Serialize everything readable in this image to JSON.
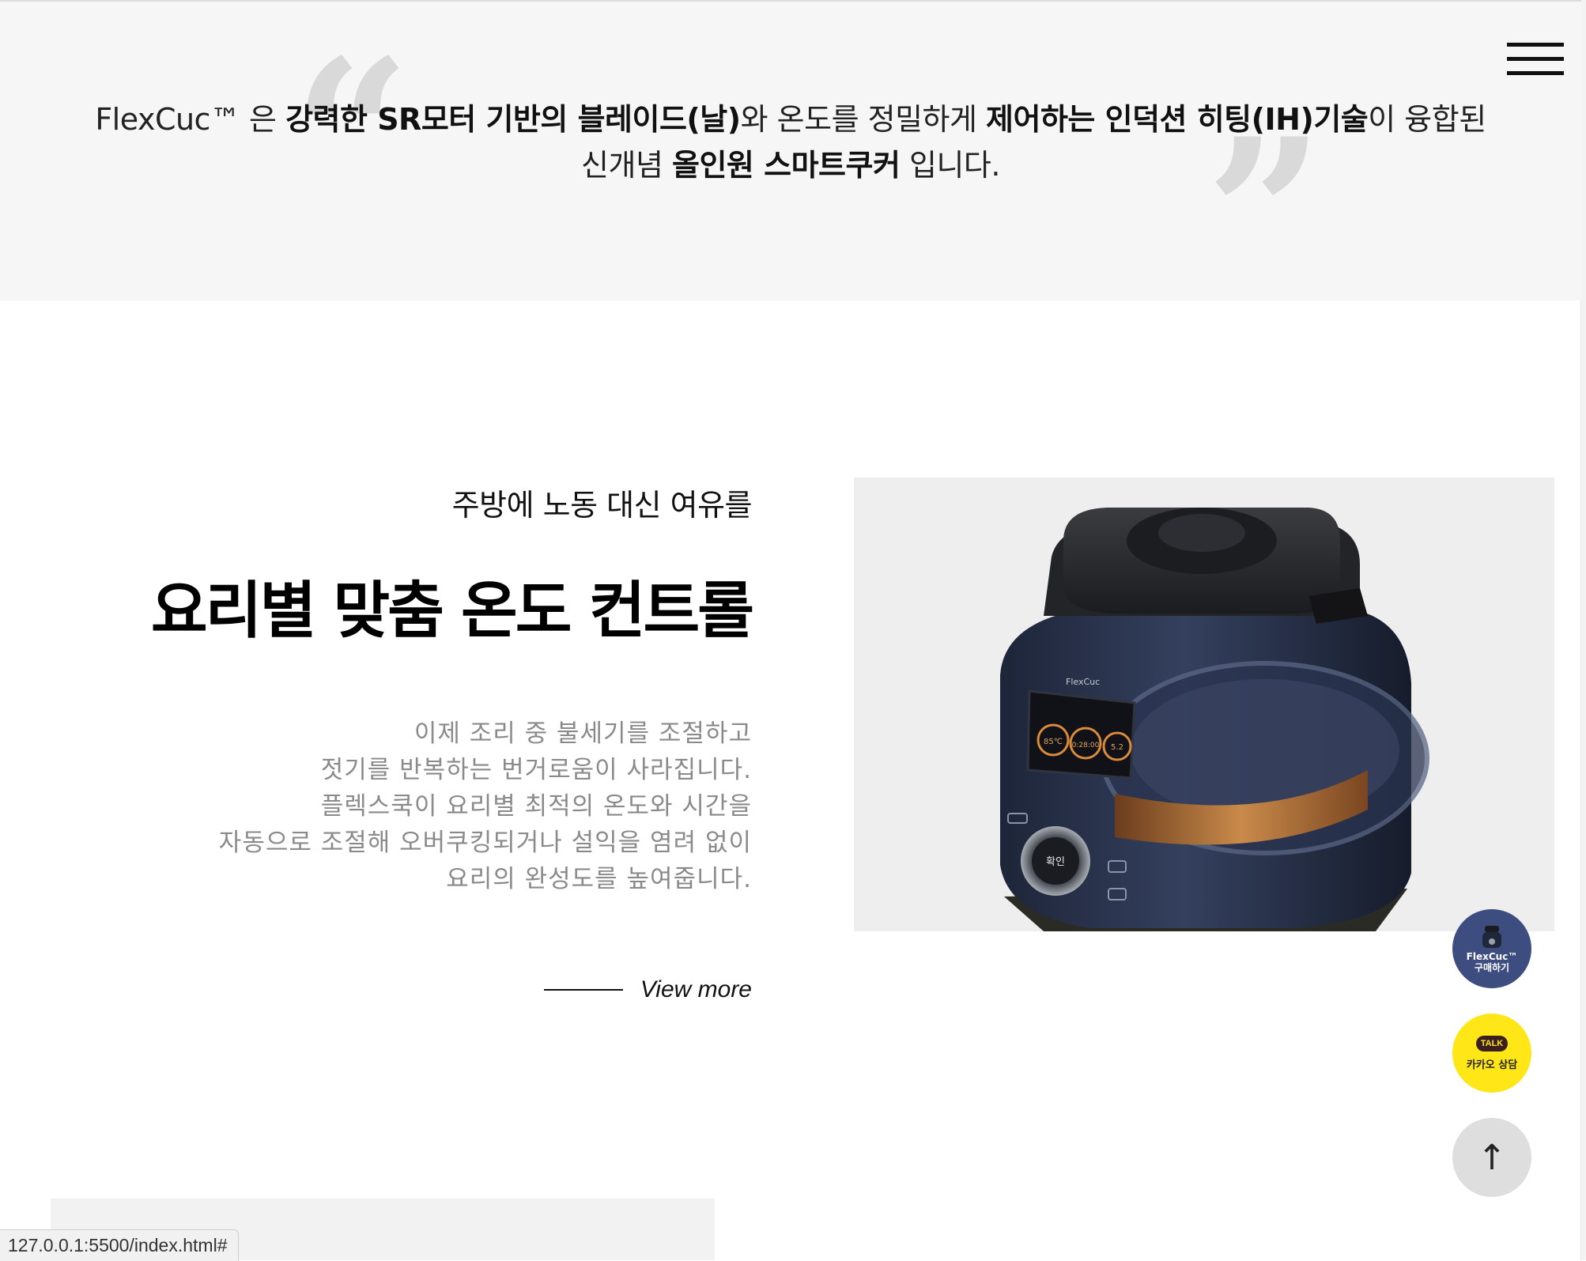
{
  "menu": {
    "icon": "hamburger-menu-icon"
  },
  "intro": {
    "parts": [
      {
        "text": "FlexCuc™ 은 ",
        "bold": false
      },
      {
        "text": "강력한 SR모터 기반의 블레이드(날)",
        "bold": true
      },
      {
        "text": "와 온도를 정밀하게 ",
        "bold": false
      },
      {
        "text": "제어하는 인덕션 히팅(IH)기술",
        "bold": true
      },
      {
        "text": "이 융합된 신개념 ",
        "bold": false
      },
      {
        "text": "올인원 스마트쿠커",
        "bold": true
      },
      {
        "text": " 입니다.",
        "bold": false
      }
    ],
    "quote_open": "“",
    "quote_close": "”"
  },
  "feature": {
    "subtitle": "주방에 노동 대신 여유를",
    "title": "요리별 맞춤 온도 컨트롤",
    "description": [
      "이제 조리 중 불세기를 조절하고",
      "젓기를 반복하는 번거로움이 사라집니다.",
      "플렉스쿡이 요리별 최적의 온도와 시간을",
      "자동으로 조절해 오버쿠킹되거나 설익을 염려 없이",
      "요리의 완성도를 높여줍니다."
    ],
    "view_more": "View more"
  },
  "product": {
    "brand": "FlexCuc",
    "display": {
      "temp": "85℃",
      "time": "0:28:00",
      "level": "5.2"
    },
    "knob_label": "확인"
  },
  "floating": {
    "buy_line1": "FlexCuc™",
    "buy_line2": "구매하기",
    "kakao_talk": "TALK",
    "kakao_label": "카카오 상담",
    "top_arrow": "↑"
  },
  "status_bar": {
    "url": "127.0.0.1:5500/index.html#"
  }
}
